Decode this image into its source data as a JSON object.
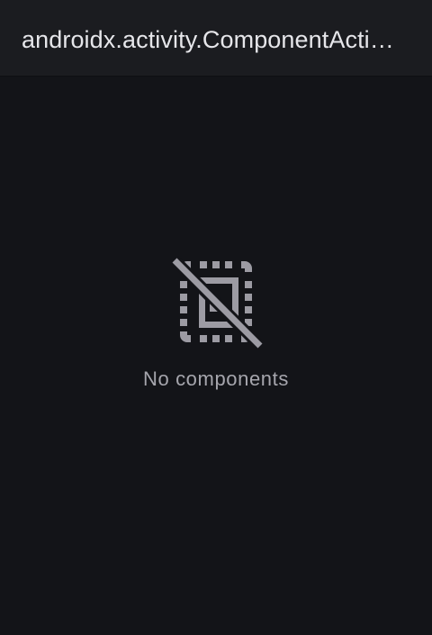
{
  "header": {
    "title": "androidx.activity.ComponentActivity"
  },
  "empty_state": {
    "icon": "no-components-icon",
    "message": "No components"
  },
  "colors": {
    "background": "#131418",
    "toolbar": "#1b1c20",
    "title_text": "#e6e6ea",
    "icon": "#9c9ba3",
    "message_text": "#a6a6ad"
  }
}
